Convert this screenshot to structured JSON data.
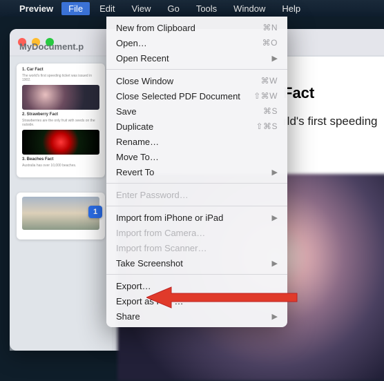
{
  "menubar": {
    "app_name": "Preview",
    "items": [
      "File",
      "Edit",
      "View",
      "Go",
      "Tools",
      "Window",
      "Help"
    ],
    "active_index": 0
  },
  "window": {
    "title": "MyDocument.p"
  },
  "sidebar": {
    "current_page_badge": "1",
    "thumbs": [
      {
        "heading": "1. Car Fact",
        "line": "The world's first speeding ticket was issued in 1902.",
        "img": "car"
      },
      {
        "heading": "2. Strawberry Fact",
        "line": "Strawberries are the only fruit with seeds on the outside.",
        "img": "straw"
      },
      {
        "heading": "3. Beaches Fact",
        "line": "Australia has over 10,000 beaches.",
        "img": ""
      }
    ],
    "thumb2_img": "beach"
  },
  "content": {
    "heading": "Fact",
    "body": "rld's first speeding"
  },
  "file_menu": {
    "groups": [
      [
        {
          "label": "New from Clipboard",
          "shortcut": "⌘N",
          "submenu": false,
          "enabled": true
        },
        {
          "label": "Open…",
          "shortcut": "⌘O",
          "submenu": false,
          "enabled": true
        },
        {
          "label": "Open Recent",
          "shortcut": "",
          "submenu": true,
          "enabled": true
        }
      ],
      [
        {
          "label": "Close Window",
          "shortcut": "⌘W",
          "submenu": false,
          "enabled": true
        },
        {
          "label": "Close Selected PDF Document",
          "shortcut": "⇧⌘W",
          "submenu": false,
          "enabled": true
        },
        {
          "label": "Save",
          "shortcut": "⌘S",
          "submenu": false,
          "enabled": true
        },
        {
          "label": "Duplicate",
          "shortcut": "⇧⌘S",
          "submenu": false,
          "enabled": true
        },
        {
          "label": "Rename…",
          "shortcut": "",
          "submenu": false,
          "enabled": true
        },
        {
          "label": "Move To…",
          "shortcut": "",
          "submenu": false,
          "enabled": true
        },
        {
          "label": "Revert To",
          "shortcut": "",
          "submenu": true,
          "enabled": true
        }
      ],
      [
        {
          "label": "Enter Password…",
          "shortcut": "",
          "submenu": false,
          "enabled": false
        }
      ],
      [
        {
          "label": "Import from iPhone or iPad",
          "shortcut": "",
          "submenu": true,
          "enabled": true
        },
        {
          "label": "Import from Camera…",
          "shortcut": "",
          "submenu": false,
          "enabled": false
        },
        {
          "label": "Import from Scanner…",
          "shortcut": "",
          "submenu": false,
          "enabled": false
        },
        {
          "label": "Take Screenshot",
          "shortcut": "",
          "submenu": true,
          "enabled": true
        }
      ],
      [
        {
          "label": "Export…",
          "shortcut": "",
          "submenu": false,
          "enabled": true
        },
        {
          "label": "Export as PDF…",
          "shortcut": "",
          "submenu": false,
          "enabled": true
        },
        {
          "label": "Share",
          "shortcut": "",
          "submenu": true,
          "enabled": true
        }
      ]
    ]
  }
}
